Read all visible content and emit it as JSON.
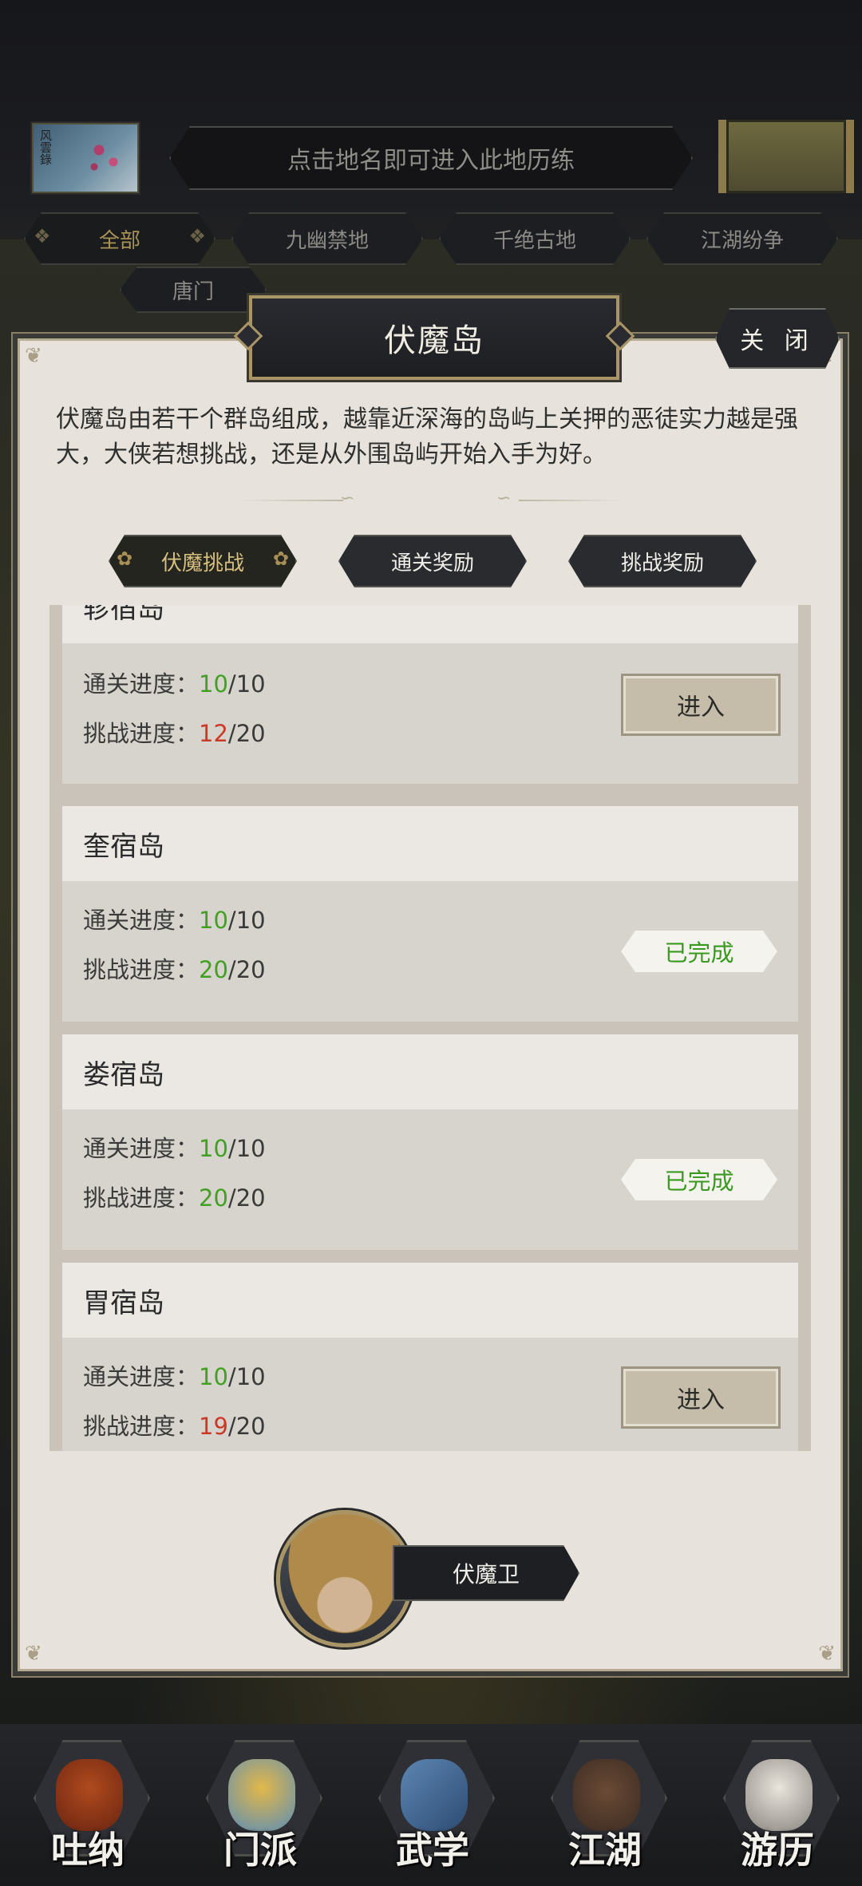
{
  "header": {
    "scroll_text": "风雲錄",
    "hint": "点击地名即可进入此地历练"
  },
  "region_tabs": [
    {
      "label": "全部",
      "active": true
    },
    {
      "label": "九幽禁地",
      "active": false
    },
    {
      "label": "千绝古地",
      "active": false
    },
    {
      "label": "江湖纷争",
      "active": false
    },
    {
      "label": "唐门",
      "active": false
    }
  ],
  "dialog": {
    "title": "伏魔岛",
    "close_label": "关 闭",
    "description": "伏魔岛由若干个群岛组成，越靠近深海的岛屿上关押的恶徒实力越是强大，大侠若想挑战，还是从外围岛屿开始入手为好。",
    "tabs": [
      {
        "label": "伏魔挑战",
        "active": true
      },
      {
        "label": "通关奖励",
        "active": false
      },
      {
        "label": "挑战奖励",
        "active": false
      }
    ],
    "progress_clear_label": "通关进度：",
    "progress_challenge_label": "挑战进度：",
    "islands": [
      {
        "name": "轸宿岛",
        "clear_done": "10",
        "clear_total": "/10",
        "challenge_done": "12",
        "challenge_total": "/20",
        "action": "进入",
        "state": "enter"
      },
      {
        "name": "奎宿岛",
        "clear_done": "10",
        "clear_total": "/10",
        "challenge_done": "20",
        "challenge_total": "/20",
        "action": "已完成",
        "state": "done"
      },
      {
        "name": "娄宿岛",
        "clear_done": "10",
        "clear_total": "/10",
        "challenge_done": "20",
        "challenge_total": "/20",
        "action": "已完成",
        "state": "done"
      },
      {
        "name": "胃宿岛",
        "clear_done": "10",
        "clear_total": "/10",
        "challenge_done": "19",
        "challenge_total": "/20",
        "action": "进入",
        "state": "enter"
      }
    ],
    "npc_name": "伏魔卫"
  },
  "bottom_nav": [
    {
      "label": "吐纳",
      "icon": "meditation-icon"
    },
    {
      "label": "门派",
      "icon": "sect-icon"
    },
    {
      "label": "武学",
      "icon": "martial-book-icon"
    },
    {
      "label": "江湖",
      "icon": "bamboo-hat-icon"
    },
    {
      "label": "游历",
      "icon": "horse-icon"
    }
  ],
  "colors": {
    "green": "#42a023",
    "red": "#cc3a27",
    "gold": "#a99566"
  }
}
